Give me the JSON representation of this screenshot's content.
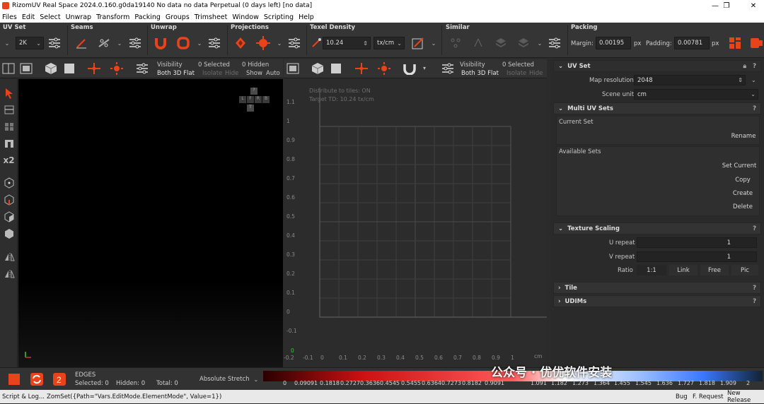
{
  "window": {
    "title": "RizomUV  Real Space 2024.0.160.g0da19140 No data no data Perpetual  (0 days left) [no data]",
    "controls": [
      "—",
      "❐",
      "✕"
    ]
  },
  "menu": [
    "Files",
    "Edit",
    "Select",
    "Unwrap",
    "Transform",
    "Packing",
    "Groups",
    "Trimsheet",
    "Window",
    "Scripting",
    "Help"
  ],
  "toolbar": {
    "groups": {
      "uvset": "UV Set",
      "seams": "Seams",
      "unwrap": "Unwrap",
      "projections": "Projections",
      "texel": "Texel Density",
      "similar": "Similar",
      "packing": "Packing"
    },
    "uvset_res": "2K",
    "texel_value": "10.24",
    "texel_unit": "tx/cm",
    "margin_label": "Margin:",
    "margin_value": "0.00195",
    "margin_unit": "px",
    "padding_label": "Padding:",
    "padding_value": "0.00781",
    "padding_unit": "px"
  },
  "viewport3d": {
    "visibility": "Visibility",
    "mode": "Both 3D Flat",
    "selected": "0 Selected",
    "isolate": "Isolate",
    "hide": "Hide",
    "hidden": "0 Hidden",
    "show": "Show",
    "auto": "Auto",
    "gizmo": [
      "?",
      "T",
      "L",
      "F",
      "R",
      "B"
    ]
  },
  "viewportuv": {
    "visibility": "Visibility",
    "mode": "Both 3D Flat",
    "selected": "0 Selected",
    "isolate": "Isolate",
    "hide": "Hide",
    "info1": "Distribute to tiles: ON",
    "info2": "Target TD: 10.24 tx/cm",
    "yticks": [
      "1.1",
      "1",
      "0.9",
      "0.8",
      "0.7",
      "0.6",
      "0.5",
      "0.4",
      "0.3",
      "0.2",
      "0.1",
      "0",
      "-0.1"
    ],
    "xticks": [
      "-0.2",
      "-0.1",
      "0",
      "0.1",
      "0.2",
      "0.3",
      "0.4",
      "0.5",
      "0.6",
      "0.7",
      "0.8",
      "0.9",
      "1"
    ],
    "x_unit": "cm",
    "origin": "0"
  },
  "rightpanel": {
    "uvset_title": "UV Set",
    "map_res_label": "Map resolution",
    "map_res_value": "2048",
    "scene_unit_label": "Scene unit",
    "scene_unit_value": "cm",
    "multi_title": "Multi UV Sets",
    "current_set": "Current Set",
    "rename": "Rename",
    "available_sets": "Available Sets",
    "set_current": "Set Current",
    "copy": "Copy",
    "create": "Create",
    "delete": "Delete",
    "texture_title": "Texture Scaling",
    "u_repeat_label": "U repeat",
    "u_repeat_value": "1",
    "v_repeat_label": "V repeat",
    "v_repeat_value": "1",
    "ratio_label": "Ratio",
    "ratio_value": "1:1",
    "link": "Link",
    "free": "Free",
    "pic": "Pic",
    "tile_title": "Tile",
    "udims_title": "UDIMs",
    "q": "?"
  },
  "bottom": {
    "mode": "EDGES",
    "selected": "Selected: 0",
    "hidden": "Hidden: 0",
    "total": "Total: 0",
    "stretch": "Absolute Stretch",
    "scale": [
      "0",
      "0.09091",
      "0.1818",
      "0.2727",
      "0.3636",
      "0.4545",
      "0.5455",
      "0.6364",
      "0.7273",
      "0.8182",
      "0.9091",
      "1.091",
      "1.182",
      "1.273",
      "1.364",
      "1.455",
      "1.545",
      "1.636",
      "1.727",
      "1.818",
      "1.909",
      "2"
    ],
    "watermark": "公众号 · 优优软件安装"
  },
  "status": {
    "script_log": "Script & Log...",
    "command": "ZomSet({Path=\"Vars.EditMode.ElementMode\", Value=1})",
    "bug": "Bug",
    "freq": "F. Request",
    "newrel": "New Release"
  },
  "colors": {
    "accent": "#e8431a",
    "panel": "#2a2a2a",
    "toolbar": "#353535"
  }
}
